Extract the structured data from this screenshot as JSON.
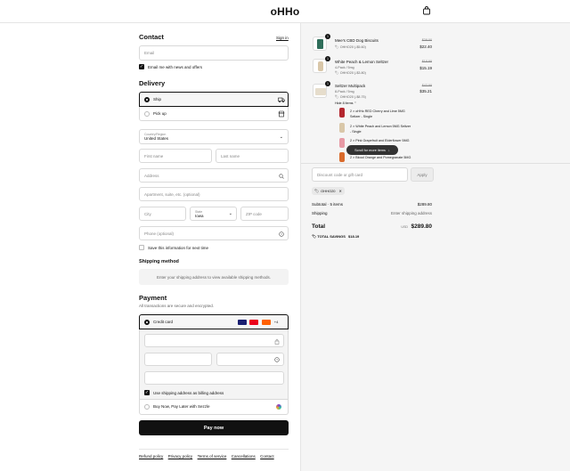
{
  "header": {
    "logo": "oHHo",
    "cart_icon": "shopping-bag-icon"
  },
  "contact": {
    "title": "Contact",
    "sign_in": "Sign in",
    "email_placeholder": "Email",
    "news_label": "Email me with news and offers",
    "news_checked": true
  },
  "delivery": {
    "title": "Delivery",
    "ship_label": "Ship",
    "pickup_label": "Pick up",
    "country_label": "Country/Region",
    "country_value": "United States",
    "first_name": "First name",
    "last_name": "Last name",
    "address": "Address",
    "apartment": "Apartment, suite, etc. (optional)",
    "city": "City",
    "state_label": "State",
    "state_value": "Iowa",
    "zip": "ZIP code",
    "phone": "Phone (optional)",
    "save_info": "Save this information for next time"
  },
  "shipping_method": {
    "title": "Shipping method",
    "message": "Enter your shipping address to view available shipping methods."
  },
  "payment": {
    "title": "Payment",
    "subtitle": "All transactions are secure and encrypted.",
    "credit_card": "Credit card",
    "more_cards": "+4",
    "billing_label": "Use shipping address as billing address",
    "sezzle": "Buy Now, Pay Later with Sezzle",
    "pay_button": "Pay now"
  },
  "footer": {
    "links": [
      "Refund policy",
      "Privacy policy",
      "Terms of service",
      "Cancellations",
      "Contact"
    ]
  },
  "order": {
    "items": [
      {
        "qty": "1",
        "name": "Mee's CBD Dog Biscuits",
        "variant": "",
        "discount": "OHHO20 (-$5.60)",
        "old_price": "$28.00",
        "price": "$22.40"
      },
      {
        "qty": "1",
        "name": "White Peach & Lemon Seltzer",
        "variant": "4-Pack / 5mg",
        "discount": "OHHO20 (-$3.80)",
        "old_price": "$18.99",
        "price": "$15.19"
      },
      {
        "qty": "1",
        "name": "Seltzer Multipack",
        "variant": "8-Pack / 5mg",
        "discount": "OHHO20 (-$8.75)",
        "old_price": "$43.99",
        "price": "$35.21"
      }
    ],
    "hide_items": "Hide 8 items",
    "bundle_items": [
      {
        "line1": "2 × oHHo RED Cherry and Lime 5MG",
        "line2": "Seltzer - Single"
      },
      {
        "line1": "2 × White Peach and Lemon 5MG Seltzer",
        "line2": "- Single"
      },
      {
        "line1": "2 × Pink Grapefruit and Elderflower 5MG",
        "line2": ""
      },
      {
        "line1": "2 × Blood Orange and Pomegranate 5MG",
        "line2": ""
      }
    ],
    "scroll_hint": "Scroll for more items",
    "discount_placeholder": "Discount code or gift card",
    "apply": "Apply",
    "code_tag": "OHHO20",
    "subtotal_label": "Subtotal · 5 items",
    "subtotal_value": "$289.80",
    "shipping_label": "Shipping",
    "shipping_value": "Enter shipping address",
    "total_label": "Total",
    "total_currency": "USD",
    "total_value": "$289.80",
    "savings_label": "TOTAL SAVINGS",
    "savings_value": "$18.19"
  }
}
